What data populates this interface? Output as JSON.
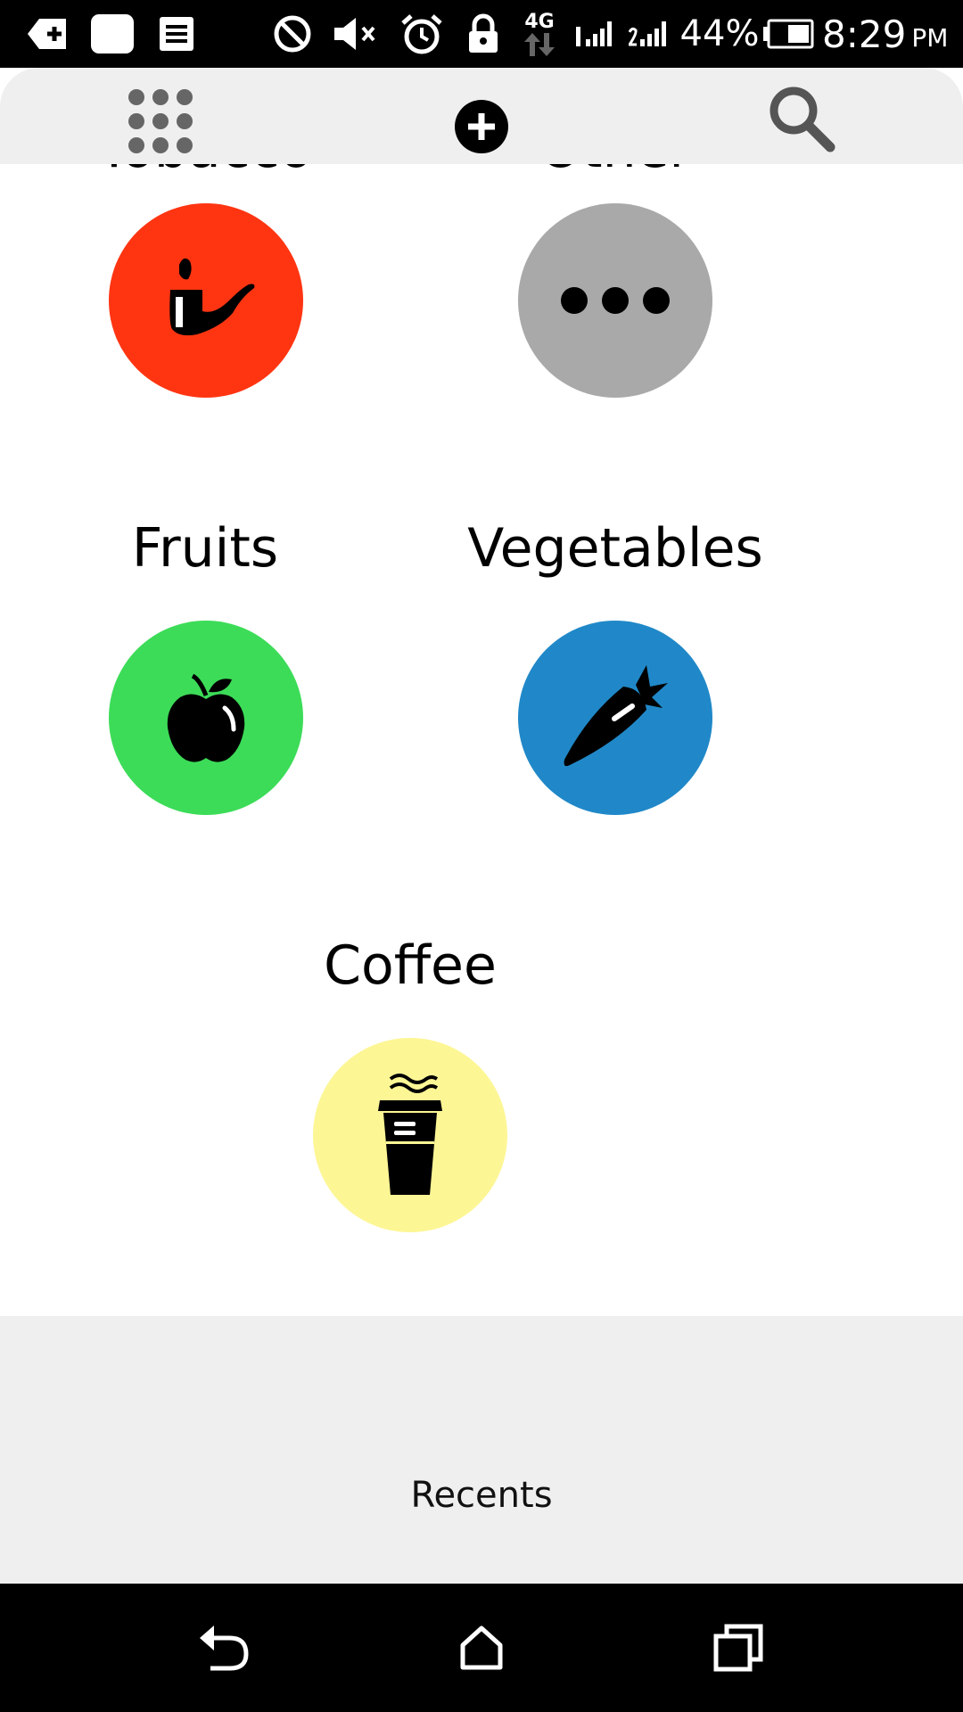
{
  "status_bar": {
    "battery_percent": "44%",
    "time": "8:29",
    "ampm": "PM",
    "network_type": "4G",
    "icons": [
      "add-notification-icon",
      "photo-icon",
      "document-icon",
      "do-not-disturb-icon",
      "mute-icon",
      "alarm-icon",
      "lock-icon",
      "data-transfer-icon",
      "signal-sim1-icon",
      "signal-sim2-icon",
      "battery-icon"
    ]
  },
  "toolbar": {
    "icons": [
      "grid-menu-icon",
      "add-circle-icon",
      "search-icon"
    ]
  },
  "categories": [
    {
      "label": "Tobacco",
      "icon": "pipe-icon",
      "color": "#ff3512"
    },
    {
      "label": "Other",
      "icon": "more-dots-icon",
      "color": "#a9a9a9"
    },
    {
      "label": "Fruits",
      "icon": "apple-icon",
      "color": "#3cdc58"
    },
    {
      "label": "Vegetables",
      "icon": "carrot-icon",
      "color": "#2088c8"
    },
    {
      "label": "Coffee",
      "icon": "coffee-cup-icon",
      "color": "#fdf695"
    }
  ],
  "recents": {
    "label": "Recents"
  },
  "nav_bar": {
    "icons": [
      "back-icon",
      "home-icon",
      "recent-apps-icon"
    ]
  }
}
